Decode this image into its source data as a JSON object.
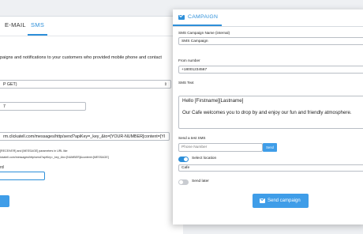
{
  "back_panel": {
    "tabs": [
      {
        "label": "E-MAIL"
      },
      {
        "label": "SMS"
      }
    ],
    "description": "paigns and notifications to your customers who provided mobile phone and contact",
    "method_select": "P GET)",
    "field_short_value": "7",
    "url_value": "rm.clickatell.com/messages/http/send?apiKey=_key_&to=[YOUR-NUMBER]content=[YI",
    "note_line1": "[RECEIVER] and [MESSAGE] parameters in URL like",
    "note_line2": "ickatell.com/messages/http/send?apiKey=_key_&to=[NUMBER]&content=[MESSAGE]",
    "password_label": "rd"
  },
  "campaign_panel": {
    "title": "CAMPAIGN",
    "name_label": "SMS Campaign Name (internal)",
    "name_value": "SMS Campaign",
    "from_label": "From number",
    "from_value": "+18001234567",
    "text_label": "SMS Text",
    "text_line1": "Hello [Firstname][Lastname]",
    "text_line2": "Our Cafe welcomes you to drop by and enjoy our fun and friendly atmosphere.",
    "test_label": "Send a test SMS",
    "phone_placeholder": "Phone Number",
    "send_label": "Send",
    "location_label": "Select location",
    "location_value": "Cafe",
    "send_later_label": "Send later",
    "send_campaign_label": "Send campaign",
    "select_location_on": true,
    "send_later_on": false
  },
  "colors": {
    "accent": "#2d8fd9",
    "button": "#3f9de8"
  }
}
